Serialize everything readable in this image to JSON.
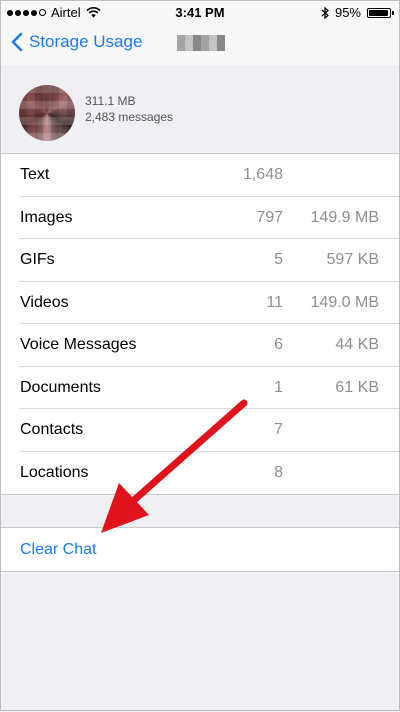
{
  "status_bar": {
    "carrier": "Airtel",
    "time": "3:41 PM",
    "battery_percent": "95%",
    "battery_level": 0.95
  },
  "nav": {
    "back_label": "Storage Usage"
  },
  "chat_header": {
    "total_size": "311.1 MB",
    "message_count": "2,483 messages"
  },
  "rows": [
    {
      "label": "Text",
      "count": "1,648",
      "size": ""
    },
    {
      "label": "Images",
      "count": "797",
      "size": "149.9 MB"
    },
    {
      "label": "GIFs",
      "count": "5",
      "size": "597 KB"
    },
    {
      "label": "Videos",
      "count": "11",
      "size": "149.0 MB"
    },
    {
      "label": "Voice Messages",
      "count": "6",
      "size": "44 KB"
    },
    {
      "label": "Documents",
      "count": "1",
      "size": "61 KB"
    },
    {
      "label": "Contacts",
      "count": "7",
      "size": ""
    },
    {
      "label": "Locations",
      "count": "8",
      "size": ""
    }
  ],
  "actions": {
    "clear_chat": "Clear Chat"
  },
  "colors": {
    "accent": "#1a7cf5",
    "annotation_arrow": "#e0121b"
  }
}
